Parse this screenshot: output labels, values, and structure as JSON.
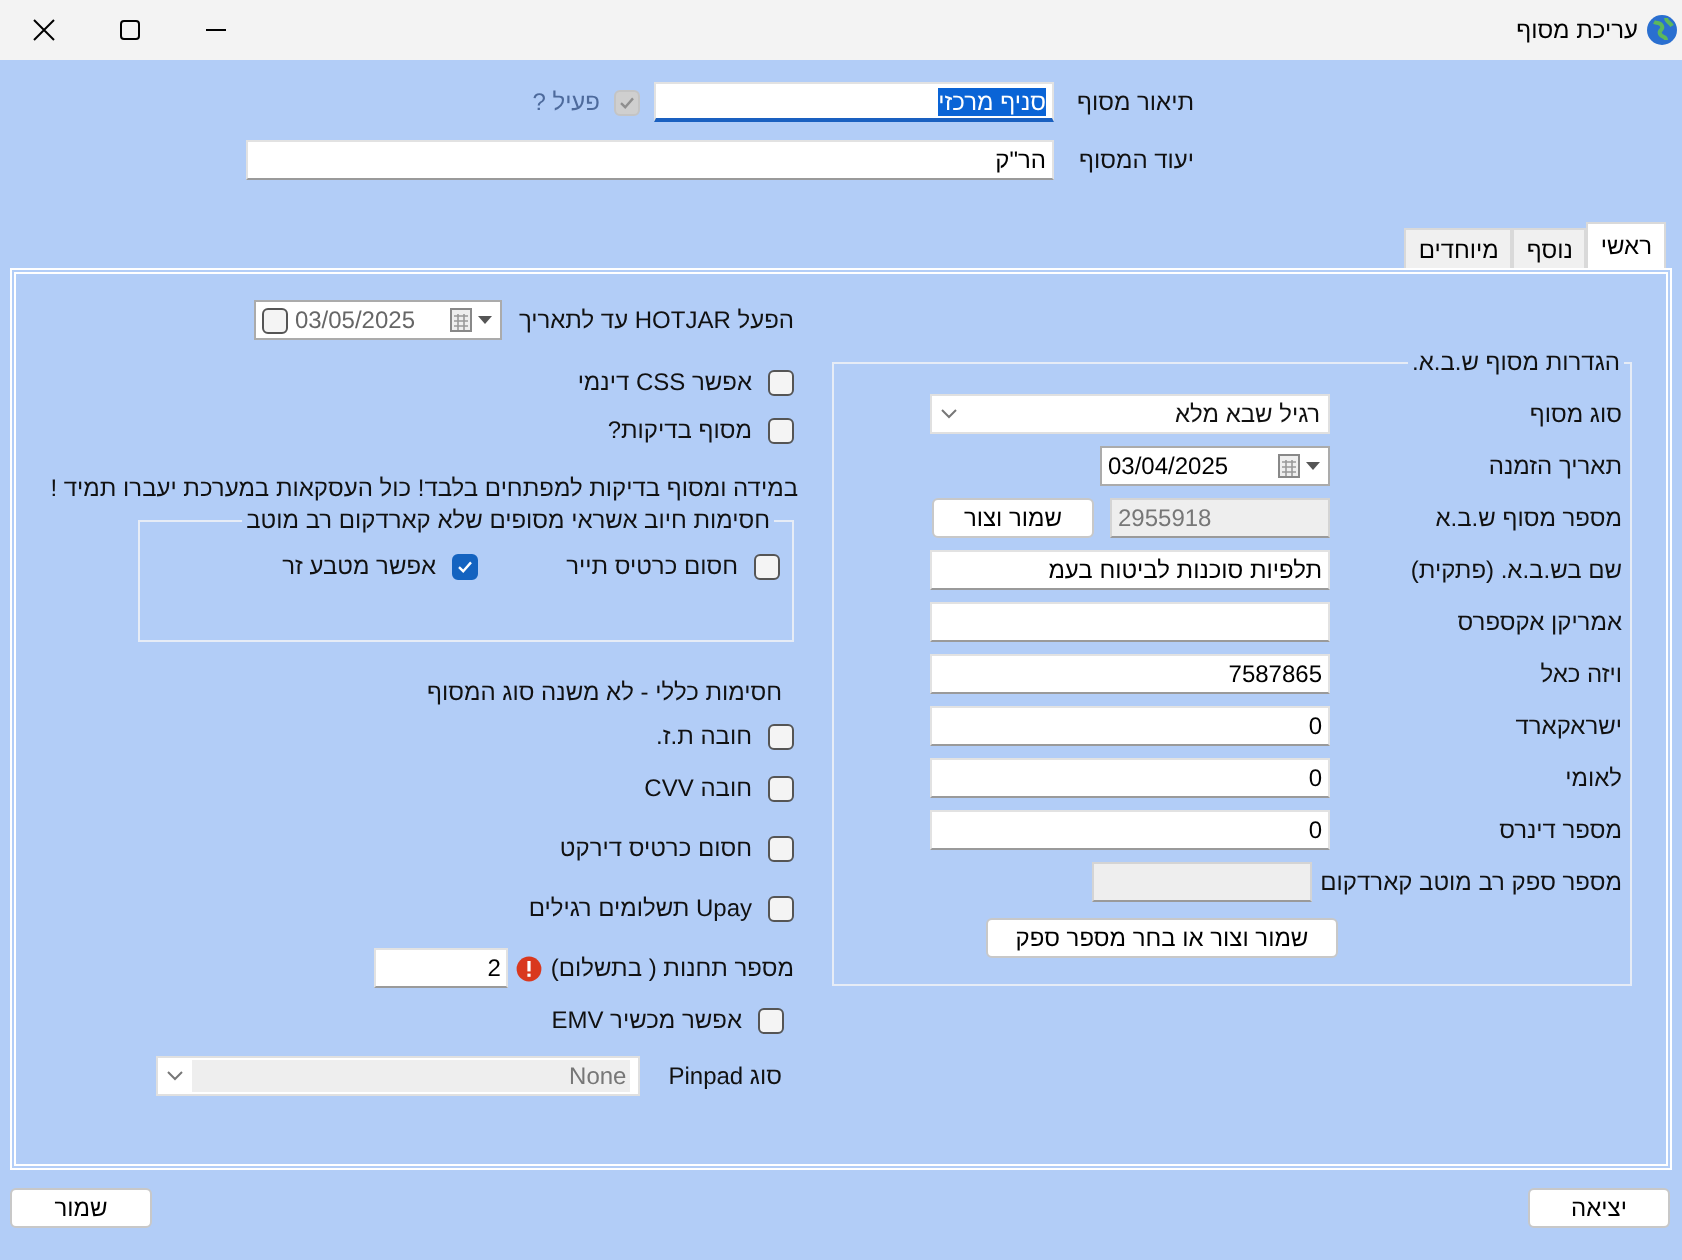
{
  "window": {
    "title": "עריכת מסוף"
  },
  "header": {
    "description": {
      "label": "תיאור מסוף",
      "value": "סניף מרכזי",
      "highlighted": true
    },
    "active": {
      "label": "פעיל ?",
      "checked": true,
      "disabled": true
    },
    "purpose": {
      "label": "יעוד המסוף",
      "value": "הר\"ק"
    }
  },
  "tabs": [
    {
      "label": "ראשי",
      "selected": true
    },
    {
      "label": "נוסף",
      "selected": false
    },
    {
      "label": "מיוחדים",
      "selected": false
    }
  ],
  "shva": {
    "title": "הגדרות מסוף ש.ב.א.",
    "fields": [
      {
        "kind": "select",
        "label": "סוג מסוף",
        "value": "רגיל שבא מלא"
      },
      {
        "kind": "date",
        "label": "תאריך הזמנה",
        "value": "03/04/2025"
      },
      {
        "kind": "readonly_button",
        "label": "מספר מסוף ש.ב.א",
        "value": "2955918",
        "button": "שמור וצור"
      },
      {
        "kind": "text",
        "label": "שם בש.ב.א. (פתקית)",
        "value": "תלפיות סוכנות לביטוח בעמ"
      },
      {
        "kind": "text",
        "label": "אמריקן אקספרס"
      },
      {
        "kind": "text",
        "label": "ויזה כאל",
        "value": "7587865"
      },
      {
        "kind": "text",
        "label": "ישראקארד",
        "value": "0"
      },
      {
        "kind": "text",
        "label": "לאומי",
        "value": "0"
      },
      {
        "kind": "text",
        "label": "מספר דינרס",
        "value": "0"
      },
      {
        "kind": "readonly",
        "label": "מספר ספק רב מוטב קארדקום"
      }
    ],
    "button": "שמור וצור או בחר מספר ספק"
  },
  "hotjar": {
    "label": "הפעל HOTJAR עד לתאריך",
    "value": "03/05/2025",
    "checked": false
  },
  "options": [
    {
      "label": "אפשר CSS  דינמי",
      "checked": false
    },
    {
      "label": "מסוף בדיקות?",
      "checked": false
    }
  ],
  "warning": "במידה ומסוף בדיקות למפתחים בלבד!  כול העסקאות במערכת יעברו תמיד !",
  "credit_block": {
    "title": "חסימות חיוב אשראי מסופים שלא קארדקום רב מוטב",
    "options": [
      {
        "label": "חסום כרטיס תייר",
        "checked": false
      },
      {
        "label": "אפשר מטבע זר",
        "checked": true
      }
    ]
  },
  "general": {
    "title": "חסימות כללי - לא משנה סוג המסוף",
    "options": [
      {
        "label": "חובה ת.ז.",
        "checked": false
      },
      {
        "label": "חובה CVV",
        "checked": false
      },
      {
        "label": "חסום כרטיס דירקט",
        "checked": false
      },
      {
        "label": "Upay תשלומים רגילים",
        "checked": false
      }
    ]
  },
  "installments": {
    "label": "מספר תחנות ( בתשלום)",
    "value": "2",
    "error": true
  },
  "emv": {
    "label": "אפשר מכשיר EMV",
    "checked": false
  },
  "pinpad": {
    "label": "סוג Pinpad",
    "value": "None",
    "disabled": true
  },
  "footer": {
    "buttons": [
      "יציאה",
      "שמור"
    ]
  }
}
